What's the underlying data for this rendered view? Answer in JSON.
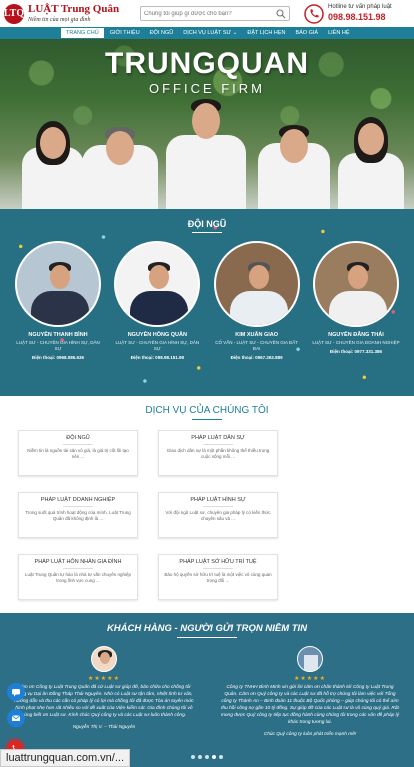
{
  "header": {
    "logo_mark": "LTQ",
    "logo_name": "LUẬT Trung Quân",
    "logo_slogan": "Niềm tin của mọi gia đình",
    "search_placeholder": "Chúng tôi giúp gì được cho bạn?",
    "hotline_label": "Hotline tư vấn pháp luật",
    "hotline_number": "098.98.151.98"
  },
  "nav": {
    "items": [
      {
        "label": "TRANG CHỦ",
        "active": true
      },
      {
        "label": "GIỚI THIỆU"
      },
      {
        "label": "ĐỘI NGŨ"
      },
      {
        "label": "DỊCH VỤ LUẬT SƯ ⌄"
      },
      {
        "label": "ĐẶT LỊCH HẸN"
      },
      {
        "label": "BÁO GIÁ"
      },
      {
        "label": "LIÊN HỆ"
      }
    ]
  },
  "hero": {
    "title": "TRUNGQUAN",
    "subtitle": "OFFICE    FIRM"
  },
  "team": {
    "title": "ĐỘI NGŨ",
    "members": [
      {
        "name": "NGUYỄN THANH BÌNH",
        "role": "LUẬT SƯ - CHUYÊN GIA HÌNH SỰ, DÂN SỰ",
        "phone": "Điện thoại: 0968.086.636"
      },
      {
        "name": "NGUYỄN HỒNG QUÂN",
        "role": "LUẬT SƯ - CHUYÊN GIA HÌNH SỰ, DÂN SỰ",
        "phone": "Điện thoại: 098.98.151.98"
      },
      {
        "name": "KIM XUÂN GIAO",
        "role": "CỐ VẤN - LUẬT SƯ - CHUYÊN GIA ĐẤT ĐAI",
        "phone": "Điện thoại: 0967.262.889"
      },
      {
        "name": "NGUYỄN ĐĂNG THÁI",
        "role": "LUẬT SƯ - CHUYÊN GIA DOANH NGHIỆP",
        "phone": "Điện thoại: 0977.331.386"
      }
    ]
  },
  "services": {
    "title": "DỊCH VỤ CỦA CHÚNG TÔI",
    "items": [
      {
        "title": "ĐỘI NGŨ",
        "desc": "Niềm tin là nguồn tài sản vô giá, là giá trị cốt lõi tạo nên ..."
      },
      {
        "title": "PHÁP LUẬT DÂN SỰ",
        "desc": "Giao dịch dân sự là một phần không thể thiếu trong cuộc sống mỗi ..."
      },
      {
        "title": "PHÁP LUẬT DOANH NGHIỆP",
        "desc": "Trong suốt quá trình hoạt động của mình, Luật Trung Quân đã không định là ..."
      },
      {
        "title": "PHÁP LUẬT HÌNH SỰ",
        "desc": "Với đội ngũ Luật sư, chuyên gia pháp lý có kiến thức chuyên sâu và ..."
      },
      {
        "title": "PHÁP LUẬT HÔN NHÂN GIA ĐÌNH",
        "desc": "Luật Trung Quân tự hào là nhà tư vấn chuyên nghiệp trong lĩnh vực cung ..."
      },
      {
        "title": "PHÁP LUẬT SỞ HỮU TRÍ TUỆ",
        "desc": "Bảo hộ quyền sở hữu trí tuệ là một việc vô cùng quan trọng đối ..."
      }
    ]
  },
  "testimonials": {
    "title": "KHÁCH HÀNG - NGƯỜI GỬI TRỌN NIỀM TIN",
    "items": [
      {
        "stars": "★★★★★",
        "text": "Cảm ơn Công ty Luật Trung Quân đã cử Luật sư giúp đỡ, bảo chữa cho chồng tôi trong vụ Dại ăn Đồng Tháp Thái Nguyên. Nhờ có Luật sư tận tâm, nhiệt tình tư vấn, hướng dẫn và thu các cần có pháp lý có lợi mà chồng tôi đã được Tòa án tuyên mức hình phạt nhẹ hơn rất nhiều so với dề xuất của Viện kiểm sát. Gia đình chúng tôi vô cùng biết ơn Luật sư. Kính chúc Quý công ty và các Luật sư luôn thành công.",
        "author": "Nguyễn Thị V. – Thái Nguyên"
      },
      {
        "stars": "★★★★★",
        "text": "Công ty TNHH Bình Minh xin gửi lời cảm ơn chân thành tới Công ty Luật Trung Quân. Cảm ơn Quý công ty và các Luật sư đã hỗ trợ chúng tôi làm việc với Tổng công ty Thành An – Binh đoàn 11 thuộc Bộ Quốc phòng – giúp chúng tôi có thể aìm thu hồi công nợ gần 10 tỷ đồng. Sự giúp đỡ của các Luật sư là vô cùng quý giá. Rất mong được Quý công ty tiếp tục đồng hành cùng chúng tôi trong các vấn đề pháp lý khác trong tương lai.",
        "author": "Chúc Quý công ty luôn phát triển mạnh mẽ!"
      }
    ],
    "dots": [
      false,
      false,
      false,
      true,
      false
    ]
  },
  "url": "luattrungquan.com.vn/..."
}
